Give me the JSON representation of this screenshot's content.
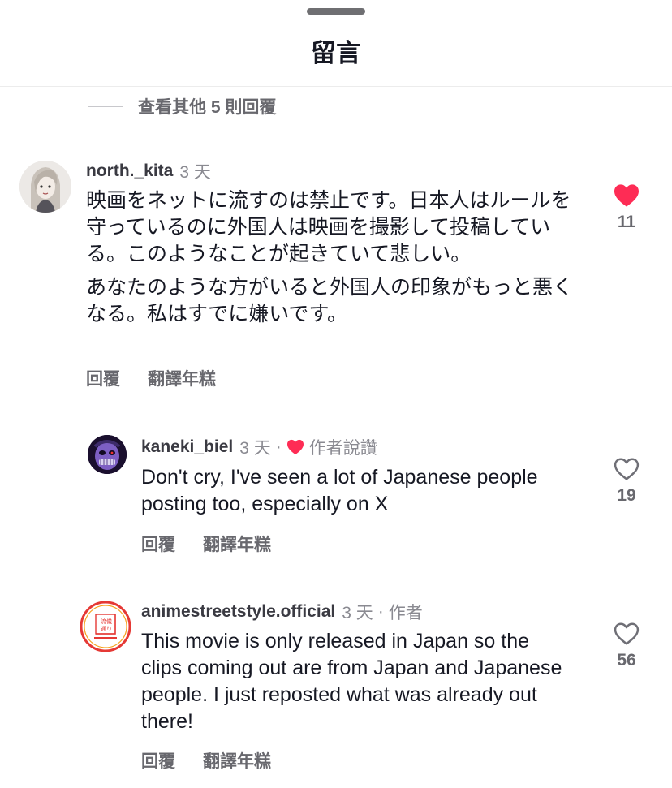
{
  "header": {
    "title": "留言"
  },
  "more_replies": {
    "label": "查看其他 5 則回覆"
  },
  "comments": [
    {
      "username": "north._kita",
      "time": "3 天",
      "paragraphs": [
        "映画をネットに流すのは禁止です。日本人はルールを守っているのに外国人は映画を撮影して投稿している。このようなことが起きていて悲しい。",
        "あなたのような方がいると外国人の印象がもっと悪くなる。私はすでに嫌いです。"
      ],
      "reply_label": "回覆",
      "translate_label": "翻譯年糕",
      "likes": "11",
      "liked": true
    },
    {
      "username": "kaneki_biel",
      "time": "3 天",
      "badge": "作者說讚",
      "paragraphs": [
        "Don't cry, I've seen a lot of Japanese people posting too, especially on X"
      ],
      "reply_label": "回覆",
      "translate_label": "翻譯年糕",
      "likes": "19",
      "liked": false
    },
    {
      "username": "animestreetstyle.official",
      "time": "3 天",
      "badge": "作者",
      "avatar_text": "流儀通り",
      "paragraphs": [
        "This movie is only released in Japan so the clips coming out are from Japan and Japanese people. I just reposted what was already out there!"
      ],
      "reply_label": "回覆",
      "translate_label": "翻譯年糕",
      "likes": "56",
      "liked": false
    }
  ],
  "colors": {
    "like_red": "#fe2c55",
    "text": "#161823",
    "secondary": "#8a8a91",
    "avatar_ring": "#e53935"
  }
}
